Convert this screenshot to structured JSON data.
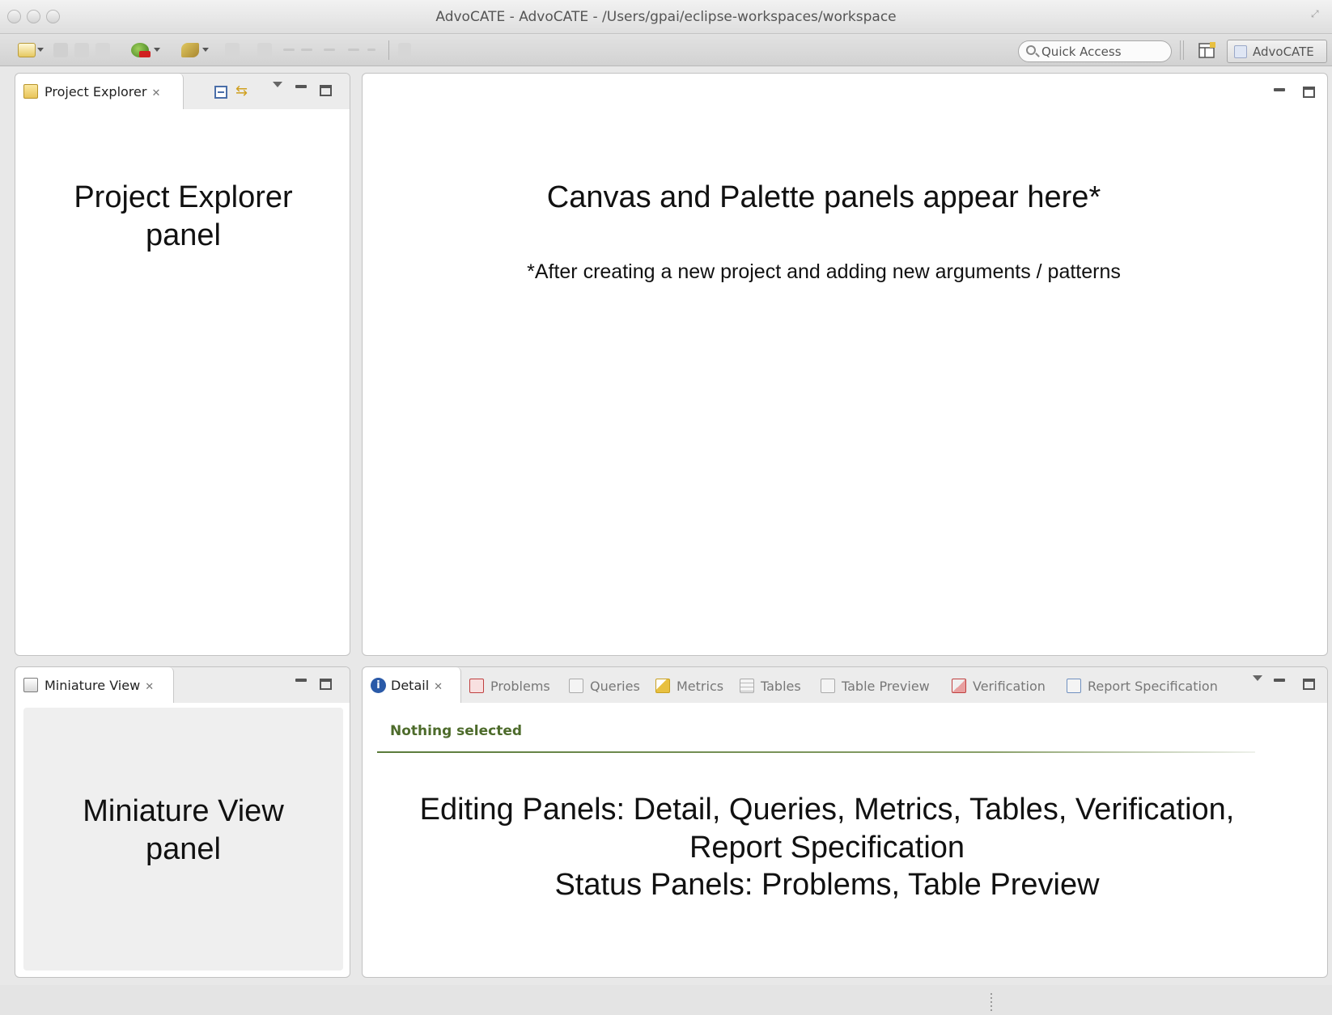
{
  "window": {
    "title": "AdvoCATE - AdvoCATE - /Users/gpai/eclipse-workspaces/workspace"
  },
  "toolbar": {
    "quick_access_placeholder": "Quick Access",
    "perspective_label": "AdvoCATE"
  },
  "project_explorer": {
    "tab_label": "Project Explorer",
    "annotation": [
      "Project Explorer",
      "panel"
    ]
  },
  "editor": {
    "annotation_title": "Canvas and Palette panels appear here*",
    "annotation_note": "*After creating a new project and adding new arguments / patterns"
  },
  "miniature_view": {
    "tab_label": "Miniature View",
    "annotation": [
      "Miniature View",
      "panel"
    ]
  },
  "bottom_views": {
    "tabs": [
      {
        "label": "Detail",
        "icon": "info-icon"
      },
      {
        "label": "Problems",
        "icon": "problems-icon"
      },
      {
        "label": "Queries",
        "icon": "queries-icon"
      },
      {
        "label": "Metrics",
        "icon": "metrics-icon"
      },
      {
        "label": "Tables",
        "icon": "tables-icon"
      },
      {
        "label": "Table Preview",
        "icon": "table-preview-icon"
      },
      {
        "label": "Verification",
        "icon": "verification-icon"
      },
      {
        "label": "Report Specification",
        "icon": "report-specification-icon"
      }
    ],
    "detail_header": "Nothing selected",
    "annotation": [
      "Editing Panels: Detail, Queries, Metrics, Tables, Verification,",
      "Report Specification",
      "Status Panels: Problems, Table Preview"
    ]
  }
}
